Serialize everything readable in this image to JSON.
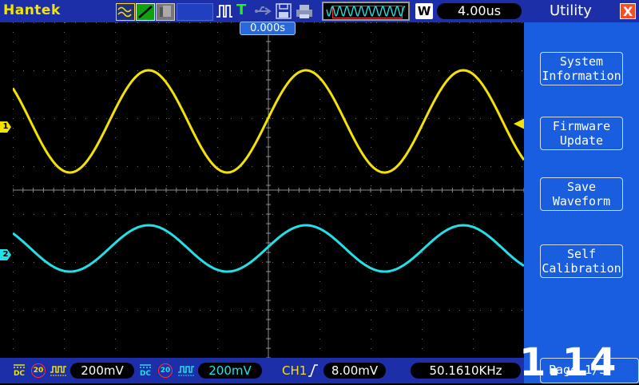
{
  "topbar": {
    "brand": "Hantek",
    "mode_label": "T",
    "memory_label": "W",
    "timebase": "4.00us"
  },
  "screen": {
    "trigger_position": "0.000s",
    "ch1_marker": "1",
    "ch2_marker": "2",
    "ch1_color": "#f4e300",
    "ch2_color": "#22e0e8"
  },
  "menu": {
    "title": "Utility",
    "close": "X",
    "buttons": [
      {
        "line1": "System",
        "line2": "Information"
      },
      {
        "line1": "Firmware",
        "line2": "Update"
      },
      {
        "line1": "Save",
        "line2": "Waveform"
      },
      {
        "line1": "Self",
        "line2": "Calibration"
      }
    ],
    "page": "Page 1/3"
  },
  "overlay": {
    "version": "1.14"
  },
  "status": {
    "ch1": {
      "coupling": "DC",
      "bw_limit": "20",
      "scale": "200mV"
    },
    "ch2": {
      "coupling": "DC",
      "bw_limit": "20",
      "scale": "200mV"
    },
    "trigger_source": "CH1",
    "trigger_level": "8.00mV",
    "frequency": "50.1610KHz"
  },
  "icons": {
    "wave_mode": "waveform-icon",
    "line_mode": "vector-line-icon",
    "persistence": "persistence-icon",
    "pulse": "pulse-icon",
    "usb": "usb-icon",
    "save": "floppy-save-icon",
    "print": "printer-icon",
    "trigger_edge": "rising-edge-icon"
  }
}
